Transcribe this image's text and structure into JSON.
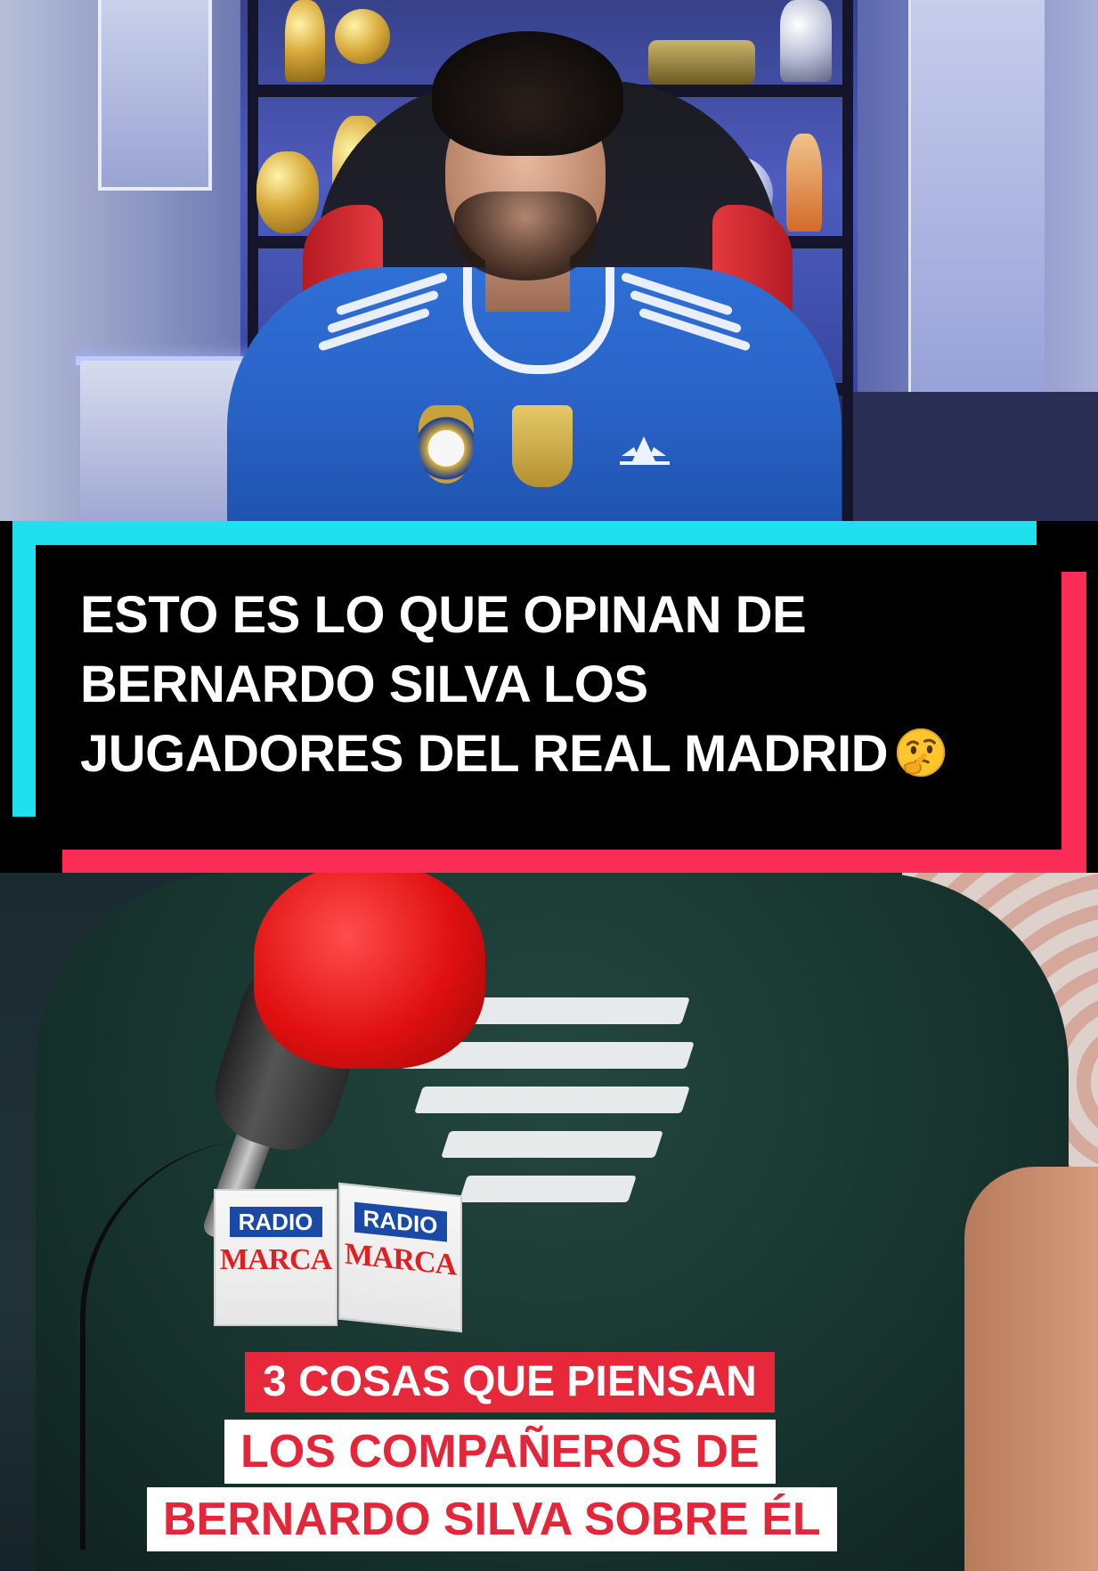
{
  "banner": {
    "lines": [
      "ESTO ES LO QUE OPINAN DE",
      "BERNARDO SILVA LOS",
      "JUGADORES DEL REAL MADRID"
    ],
    "emoji_icon": "thinking-face-icon"
  },
  "clip": {
    "mic_flag": {
      "line1": "RADIO",
      "line2": "MARCA"
    },
    "caption": {
      "red_line": "3 COSAS QUE PIENSAN",
      "white_line1": "LOS COMPAÑEROS DE",
      "white_line2": "BERNARDO SILVA SOBRE ÉL"
    }
  },
  "colors": {
    "banner_cyan": "#1ee0ee",
    "banner_pink": "#fb2c55",
    "caption_red": "#e6283a",
    "jersey_blue": "#2f6fd6",
    "mic_red": "#e01010"
  }
}
